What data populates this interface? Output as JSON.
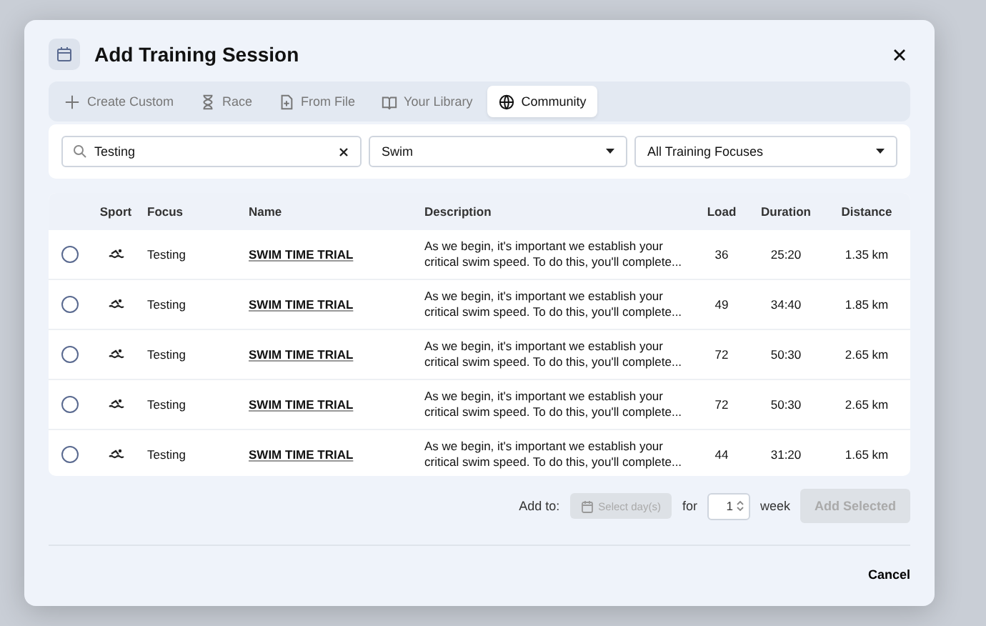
{
  "dialog": {
    "title": "Add Training Session"
  },
  "tabs": [
    {
      "label": "Create Custom",
      "selected": false
    },
    {
      "label": "Race",
      "selected": false
    },
    {
      "label": "From File",
      "selected": false
    },
    {
      "label": "Your Library",
      "selected": false
    },
    {
      "label": "Community",
      "selected": true
    }
  ],
  "filters": {
    "search": {
      "value": "Testing"
    },
    "sport": {
      "value": "Swim"
    },
    "focus": {
      "value": "All Training Focuses"
    }
  },
  "table": {
    "columns": [
      "Sport",
      "Focus",
      "Name",
      "Description",
      "Load",
      "Duration",
      "Distance"
    ],
    "rows": [
      {
        "checked": false,
        "focus": "Testing",
        "name": "SWIM TIME TRIAL",
        "description": "As we begin, it's important we establish your critical swim speed. To do this, you'll complete...",
        "load": "36",
        "duration": "25:20",
        "distance": "1.35 km"
      },
      {
        "checked": false,
        "focus": "Testing",
        "name": "SWIM TIME TRIAL",
        "description": "As we begin, it's important we establish your critical swim speed. To do this, you'll complete...",
        "load": "49",
        "duration": "34:40",
        "distance": "1.85 km"
      },
      {
        "checked": false,
        "focus": "Testing",
        "name": "SWIM TIME TRIAL",
        "description": "As we begin, it's important we establish your critical swim speed. To do this, you'll complete...",
        "load": "72",
        "duration": "50:30",
        "distance": "2.65 km"
      },
      {
        "checked": false,
        "focus": "Testing",
        "name": "SWIM TIME TRIAL",
        "description": "As we begin, it's important we establish your critical swim speed. To do this, you'll complete...",
        "load": "72",
        "duration": "50:30",
        "distance": "2.65 km"
      },
      {
        "checked": false,
        "focus": "Testing",
        "name": "SWIM TIME TRIAL",
        "description": "As we begin, it's important we establish your critical swim speed. To do this, you'll complete...",
        "load": "44",
        "duration": "31:20",
        "distance": "1.65 km"
      }
    ]
  },
  "add_bar": {
    "label": "Add to:",
    "day_picker": {
      "placeholder": "Select day(s)",
      "disabled": true
    },
    "for_label": "for",
    "weeks": {
      "value": "1"
    },
    "week_label": "week",
    "add_button": {
      "label": "Add Selected",
      "disabled": true
    }
  },
  "buttons": [
    {
      "label": "Cancel"
    }
  ]
}
